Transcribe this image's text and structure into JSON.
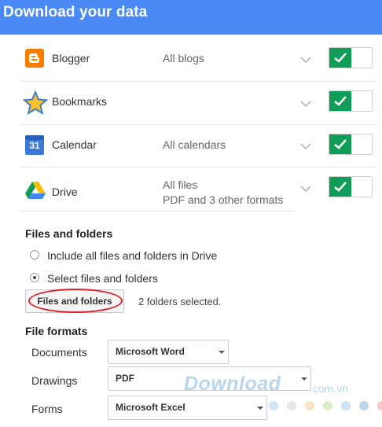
{
  "header": {
    "title": "Download your data"
  },
  "services": [
    {
      "name": "Blogger",
      "detail": "All blogs",
      "detail2": "",
      "icon": "blogger-icon",
      "enabled": true
    },
    {
      "name": "Bookmarks",
      "detail": "",
      "detail2": "",
      "icon": "bookmarks-star-icon",
      "enabled": true
    },
    {
      "name": "Calendar",
      "detail": "All calendars",
      "detail2": "",
      "icon": "calendar-icon",
      "calendar_day": "31",
      "enabled": true
    },
    {
      "name": "Drive",
      "detail": "All files",
      "detail2": "PDF and 3 other formats",
      "icon": "drive-icon",
      "enabled": true
    }
  ],
  "files_folders": {
    "title": "Files and folders",
    "option_all": "Include all files and folders in Drive",
    "option_select": "Select files and folders",
    "selected_option": "select",
    "button_label": "Files and folders",
    "selected_count": "2 folders selected."
  },
  "file_formats": {
    "title": "File formats",
    "rows": [
      {
        "label": "Documents",
        "value": "Microsoft Word"
      },
      {
        "label": "Drawings",
        "value": "PDF"
      },
      {
        "label": "Forms",
        "value": "Microsoft Excel"
      }
    ]
  },
  "watermark": {
    "text": "Download",
    "domain": ".com.vn"
  },
  "colors": {
    "header": "#4a8af4",
    "toggle_on": "#0f9d58",
    "highlight_oval": "#d9242e",
    "watermark_dots": [
      "#cfe6f7",
      "#e6e6e6",
      "#fbe3c6",
      "#d9efc9",
      "#c9e3f7",
      "#bcd6ee",
      "#f7c9c9"
    ]
  }
}
